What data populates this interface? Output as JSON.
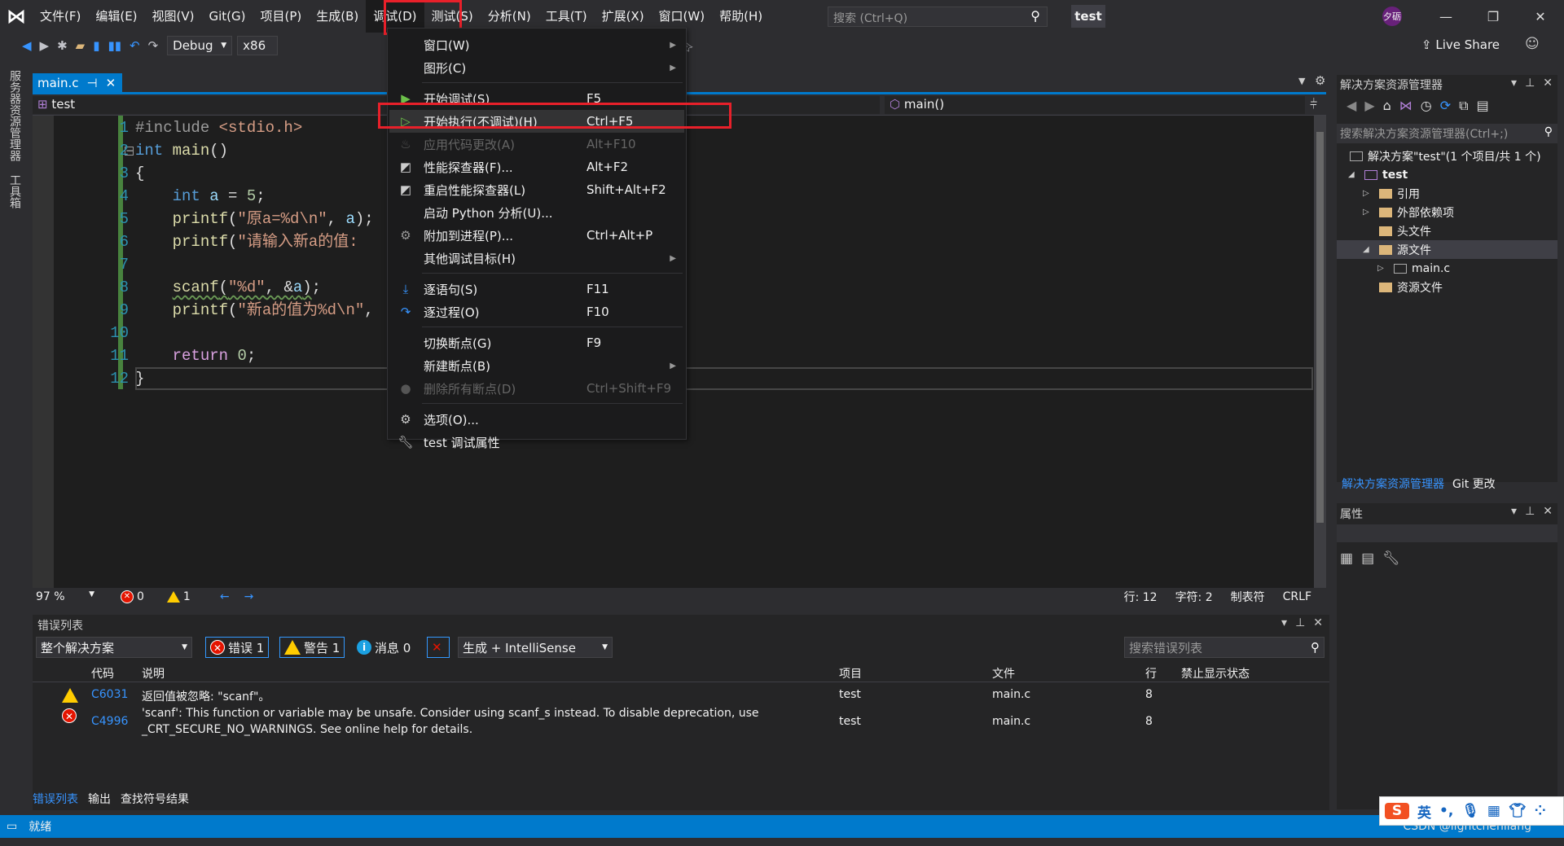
{
  "titlebar": {
    "menus": [
      "文件(F)",
      "编辑(E)",
      "视图(V)",
      "Git(G)",
      "项目(P)",
      "生成(B)",
      "调试(D)",
      "测试(S)",
      "分析(N)",
      "工具(T)",
      "扩展(X)",
      "窗口(W)",
      "帮助(H)"
    ],
    "active_menu": "调试(D)",
    "search_placeholder": "搜索 (Ctrl+Q)",
    "project_name": "test",
    "avatar_text": "夕砺",
    "minimize": "—",
    "restore": "❐",
    "close": "✕"
  },
  "toolbar": {
    "config": "Debug",
    "platform": "x86",
    "live_share": "Live Share"
  },
  "left_tabs": [
    "服务器资源管理器",
    "工具箱"
  ],
  "editor": {
    "tab": {
      "label": "main.c",
      "pin": "⊣",
      "close": "✕"
    },
    "nav_project": "test",
    "nav_member": "main()",
    "lines": [
      {
        "n": "1",
        "tokens": [
          [
            "pp",
            "#include"
          ],
          [
            "inc",
            " <stdio.h>"
          ]
        ]
      },
      {
        "n": "2",
        "tokens": [
          [
            "kw",
            "int"
          ],
          [
            "op",
            " "
          ],
          [
            "fn",
            "main"
          ],
          [
            "op",
            "()"
          ]
        ]
      },
      {
        "n": "3",
        "tokens": [
          [
            "op",
            "{"
          ]
        ]
      },
      {
        "n": "4",
        "tokens": [
          [
            "op",
            "    "
          ],
          [
            "kw",
            "int"
          ],
          [
            "op",
            " "
          ],
          [
            "var",
            "a"
          ],
          [
            "op",
            " = "
          ],
          [
            "num",
            "5"
          ],
          [
            "op",
            ";"
          ]
        ]
      },
      {
        "n": "5",
        "tokens": [
          [
            "op",
            "    "
          ],
          [
            "fn",
            "printf"
          ],
          [
            "op",
            "("
          ],
          [
            "str",
            "\"原a=%d\\n\""
          ],
          [
            "op",
            ", "
          ],
          [
            "var",
            "a"
          ],
          [
            "op",
            ");"
          ]
        ]
      },
      {
        "n": "6",
        "tokens": [
          [
            "op",
            "    "
          ],
          [
            "fn",
            "printf"
          ],
          [
            "op",
            "("
          ],
          [
            "str",
            "\"请输入新a的值:"
          ]
        ]
      },
      {
        "n": "7",
        "tokens": []
      },
      {
        "n": "8",
        "tokens": [
          [
            "op",
            "    "
          ],
          [
            "fn",
            "scanf",
            "squig"
          ],
          [
            "op",
            "(",
            "squig"
          ],
          [
            "str",
            "\"%d\"",
            "squig"
          ],
          [
            "op",
            ", &",
            "squig"
          ],
          [
            "var",
            "a",
            "squig"
          ],
          [
            "op",
            ")",
            "squig"
          ],
          [
            "op",
            ";"
          ]
        ]
      },
      {
        "n": "9",
        "tokens": [
          [
            "op",
            "    "
          ],
          [
            "fn",
            "printf"
          ],
          [
            "op",
            "("
          ],
          [
            "str",
            "\"新a的值为%d\\n\""
          ],
          [
            "op",
            ","
          ]
        ]
      },
      {
        "n": "10",
        "tokens": []
      },
      {
        "n": "11",
        "tokens": [
          [
            "op",
            "    "
          ],
          [
            "ctl",
            "return"
          ],
          [
            "op",
            " "
          ],
          [
            "num",
            "0"
          ],
          [
            "op",
            ";"
          ]
        ]
      },
      {
        "n": "12",
        "tokens": [
          [
            "op",
            "}"
          ]
        ]
      }
    ],
    "status": {
      "zoom": "97 %",
      "errors": "0",
      "warnings": "1",
      "line": "行: 12",
      "char": "字符: 2",
      "indent": "制表符",
      "eol": "CRLF"
    }
  },
  "debug_menu": [
    {
      "label": "窗口(W)",
      "shortcut": "",
      "submenu": true
    },
    {
      "label": "图形(C)",
      "shortcut": "",
      "submenu": true
    },
    {
      "sep": true
    },
    {
      "label": "开始调试(S)",
      "shortcut": "F5",
      "icon": "play-icon"
    },
    {
      "label": "开始执行(不调试)(H)",
      "shortcut": "Ctrl+F5",
      "icon": "play-outline-icon",
      "highlighted": true
    },
    {
      "label": "应用代码更改(A)",
      "shortcut": "Alt+F10",
      "icon": "flame-icon",
      "disabled": true
    },
    {
      "label": "性能探查器(F)...",
      "shortcut": "Alt+F2",
      "icon": "chart-icon"
    },
    {
      "label": "重启性能探查器(L)",
      "shortcut": "Shift+Alt+F2",
      "icon": "chart-icon"
    },
    {
      "label": "启动 Python 分析(U)...",
      "shortcut": ""
    },
    {
      "label": "附加到进程(P)...",
      "shortcut": "Ctrl+Alt+P",
      "icon": "gears-icon"
    },
    {
      "label": "其他调试目标(H)",
      "shortcut": "",
      "submenu": true
    },
    {
      "sep": true
    },
    {
      "label": "逐语句(S)",
      "shortcut": "F11",
      "icon": "step-into-icon"
    },
    {
      "label": "逐过程(O)",
      "shortcut": "F10",
      "icon": "step-over-icon"
    },
    {
      "sep": true
    },
    {
      "label": "切换断点(G)",
      "shortcut": "F9"
    },
    {
      "label": "新建断点(B)",
      "shortcut": "",
      "submenu": true
    },
    {
      "label": "删除所有断点(D)",
      "shortcut": "Ctrl+Shift+F9",
      "icon": "delete-breakpoints-icon",
      "disabled": true
    },
    {
      "sep": true
    },
    {
      "label": "选项(O)...",
      "shortcut": "",
      "icon": "gear-icon"
    },
    {
      "label": "test 调试属性",
      "shortcut": "",
      "icon": "wrench-icon"
    }
  ],
  "error_list": {
    "title": "错误列表",
    "scope": "整个解决方案",
    "errors_btn": "错误 1",
    "warnings_btn": "警告 1",
    "messages_btn": "消息 0",
    "source": "生成 + IntelliSense",
    "search_placeholder": "搜索错误列表",
    "columns": [
      "代码",
      "说明",
      "项目",
      "文件",
      "行",
      "禁止显示状态"
    ],
    "rows": [
      {
        "type": "warning",
        "code": "C6031",
        "desc": "返回值被忽略: \"scanf\"。",
        "desc2": "",
        "project": "test",
        "file": "main.c",
        "line": "8"
      },
      {
        "type": "error",
        "code": "C4996",
        "desc": "'scanf': This function or variable may be unsafe. Consider using scanf_s instead. To disable deprecation, use",
        "desc2": "_CRT_SECURE_NO_WARNINGS. See online help for details.",
        "project": "test",
        "file": "main.c",
        "line": "8"
      }
    ],
    "bottom_tabs": [
      "错误列表",
      "输出",
      "查找符号结果"
    ]
  },
  "solution_explorer": {
    "title": "解决方案资源管理器",
    "search_placeholder": "搜索解决方案资源管理器(Ctrl+;)",
    "tree": [
      {
        "label": "解决方案\"test\"(1 个项目/共 1 个)",
        "level": 0,
        "expander": ""
      },
      {
        "label": "test",
        "level": 1,
        "expander": "◢",
        "bold": true
      },
      {
        "label": "引用",
        "level": 2,
        "expander": "▷"
      },
      {
        "label": "外部依赖项",
        "level": 2,
        "expander": "▷"
      },
      {
        "label": "头文件",
        "level": 2,
        "expander": ""
      },
      {
        "label": "源文件",
        "level": 2,
        "expander": "◢",
        "selected": true
      },
      {
        "label": "main.c",
        "level": 3,
        "expander": "▷"
      },
      {
        "label": "资源文件",
        "level": 2,
        "expander": ""
      }
    ],
    "tabs": [
      "解决方案资源管理器",
      "Git 更改"
    ]
  },
  "properties": {
    "title": "属性"
  },
  "statusbar": {
    "text": "就绪",
    "watermark": "CSDN @lightchenliang"
  },
  "ime": {
    "lang": "英"
  },
  "colors": {
    "accent": "#007acc",
    "highlight_box": "#e8202a",
    "background": "#2d2d30",
    "editor": "#1e1e1e"
  }
}
